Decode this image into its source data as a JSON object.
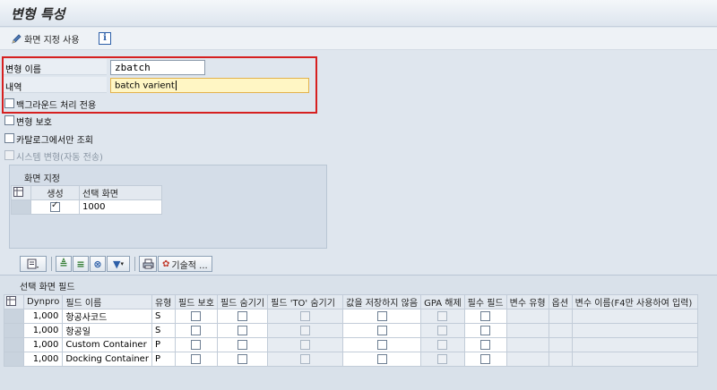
{
  "window": {
    "title": "변형 특성"
  },
  "toolbar": {
    "screen_assign_label": "화면 지정 사용",
    "info_label": "i"
  },
  "form": {
    "variant_name_label": "변형 이름",
    "variant_name_value": "zbatch",
    "description_label": "내역",
    "description_value": "batch varient",
    "background_only_label": "백그라운드 처리 전용",
    "protect_label": "변형 보호",
    "catalog_only_label": "카탈로그에서만 조회",
    "system_variant_label": "시스템 변형(자동 전송)"
  },
  "screen_assignment": {
    "title": "화면 지정",
    "headers": [
      "생성",
      "선택 화면"
    ],
    "rows": [
      {
        "created": true,
        "screen": "1000"
      }
    ]
  },
  "alv_toolbar": {
    "technical_label": "기술적 ..."
  },
  "selection_fields": {
    "title": "선택 화면 필드",
    "headers": [
      "Dynpro",
      "필드 이름",
      "유형",
      "필드 보호",
      "필드 숨기기",
      "필드 'TO' 숨기기",
      "값을 저장하지 않음",
      "GPA 해제",
      "필수 필드",
      "변수 유형",
      "옵션",
      "변수 이름(F4만 사용하여 입력)"
    ],
    "rows": [
      {
        "dynpro": "1,000",
        "name": "항공사코드",
        "type": "S"
      },
      {
        "dynpro": "1,000",
        "name": "항공일",
        "type": "S"
      },
      {
        "dynpro": "1,000",
        "name": "Custom Container",
        "type": "P"
      },
      {
        "dynpro": "1,000",
        "name": "Docking Container",
        "type": "P"
      }
    ]
  }
}
